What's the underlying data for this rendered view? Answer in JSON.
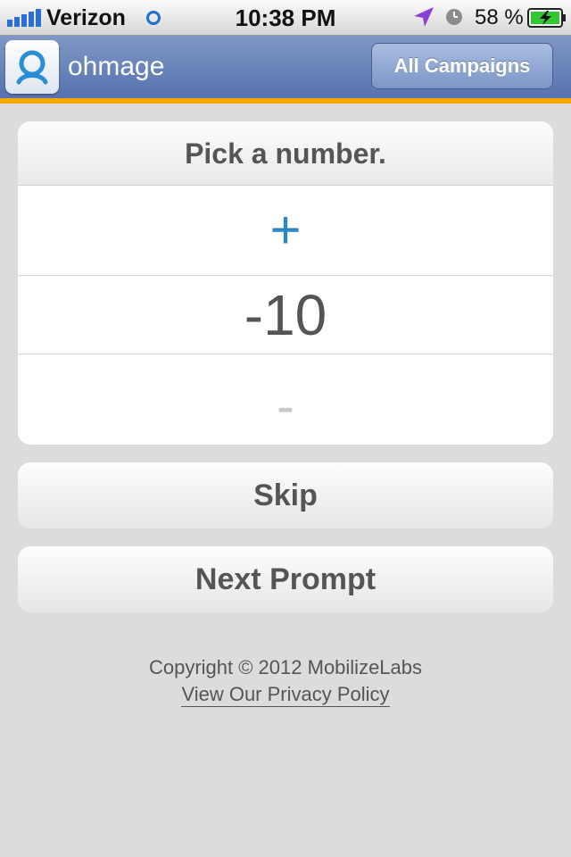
{
  "status_bar": {
    "carrier": "Verizon",
    "time": "10:38 PM",
    "battery": "58 %",
    "icons": [
      "signal-bars-icon",
      "activity-icon",
      "location-icon",
      "alarm-icon",
      "battery-charging-icon"
    ]
  },
  "nav": {
    "app_name": "ohmage",
    "logo_icon": "ohmage-logo-icon",
    "campaigns_button": "All Campaigns"
  },
  "prompt": {
    "question": "Pick a number.",
    "increment_symbol": "+",
    "value": "-10",
    "decrement_symbol": "-"
  },
  "actions": {
    "skip": "Skip",
    "next": "Next Prompt"
  },
  "footer": {
    "copyright": "Copyright © 2012 MobilizeLabs",
    "privacy_link": "View Our Privacy Policy"
  },
  "colors": {
    "nav_background": "#6a84bb",
    "accent_stripe": "#f6a800",
    "increment_color": "#2a86c4",
    "page_background": "#dcdcdc"
  }
}
